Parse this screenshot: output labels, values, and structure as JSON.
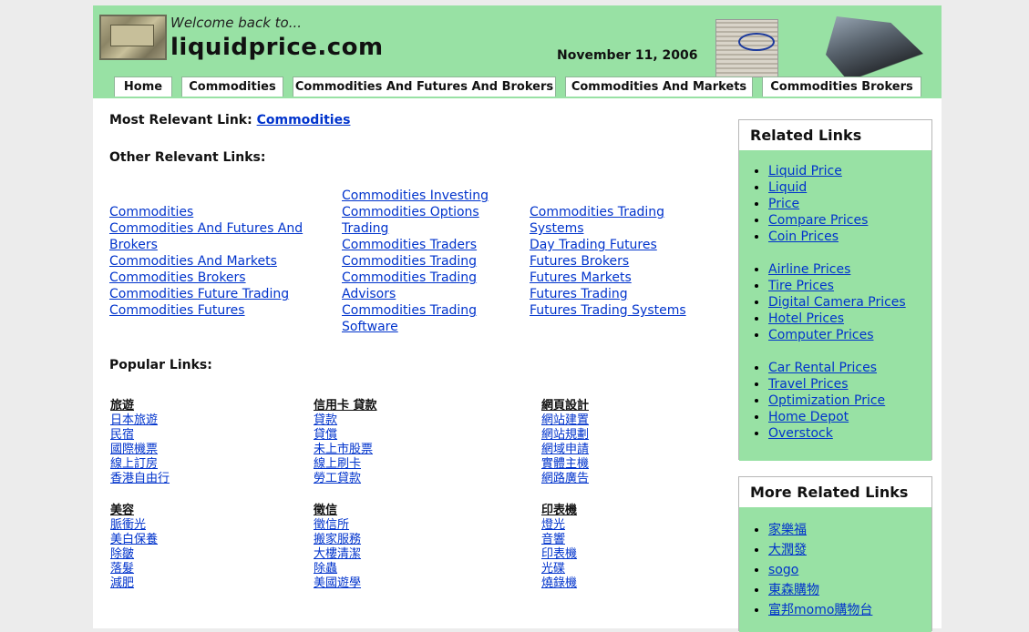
{
  "header": {
    "welcome": "Welcome back to...",
    "site_name": "liquidprice.com",
    "date": "November 11, 2006"
  },
  "tabs": [
    {
      "label": "Home"
    },
    {
      "label": "Commodities"
    },
    {
      "label": "Commodities And Futures And Brokers"
    },
    {
      "label": "Commodities And Markets"
    },
    {
      "label": "Commodities Brokers"
    }
  ],
  "main": {
    "most_relevant_label": "Most Relevant Link:",
    "most_relevant_link": "Commodities",
    "other_label": "Other Relevant Links:",
    "col1": [
      "Commodities",
      "Commodities And Futures And Brokers",
      "Commodities And Markets",
      "Commodities Brokers",
      "Commodities Future Trading",
      "Commodities Futures"
    ],
    "col2": [
      "Commodities Investing",
      "Commodities Options Trading",
      "Commodities Traders",
      "Commodities Trading",
      "Commodities Trading Advisors",
      "Commodities Trading Software"
    ],
    "col3": [
      "Commodities Trading Systems",
      "Day Trading Futures",
      "Futures Brokers",
      "Futures Markets",
      "Futures Trading",
      "Futures Trading Systems"
    ],
    "popular_label": "Popular Links:",
    "popular": [
      {
        "cat": "旅遊",
        "links": [
          "日本旅遊",
          "民宿",
          "國際機票",
          "線上訂房",
          "香港自由行"
        ]
      },
      {
        "cat": "信用卡 貸款",
        "links": [
          "貸款",
          "貸償",
          "未上市股票",
          "線上刷卡",
          "勞工貸款"
        ]
      },
      {
        "cat": "網頁設計",
        "links": [
          "網站建置",
          "網站規劃",
          "網域申請",
          "實體主機",
          "網路廣告"
        ]
      },
      {
        "cat": "美容",
        "links": [
          "脈衝光",
          "美白保養",
          "除皺",
          "落髮",
          "減肥"
        ]
      },
      {
        "cat": "徵信",
        "links": [
          "徵信所",
          "搬家服務",
          "大樓清潔",
          "除蟲",
          "美國遊學"
        ]
      },
      {
        "cat": "印表機",
        "links": [
          "燈光",
          "音響",
          "印表機",
          "光碟",
          "燒錄機"
        ]
      }
    ]
  },
  "sidebar": {
    "related_title": "Related Links",
    "related_groups": [
      [
        "Liquid Price",
        "Liquid",
        "Price",
        "Compare Prices",
        "Coin Prices"
      ],
      [
        "Airline Prices",
        "Tire Prices",
        "Digital Camera Prices",
        "Hotel Prices",
        "Computer Prices"
      ],
      [
        "Car Rental Prices",
        "Travel Prices",
        "Optimization Price",
        "Home Depot",
        "Overstock"
      ]
    ],
    "more_title": "More Related Links",
    "more_links": [
      "家樂福",
      "大潤發",
      "sogo",
      "東森購物",
      "富邦momo購物台"
    ]
  }
}
